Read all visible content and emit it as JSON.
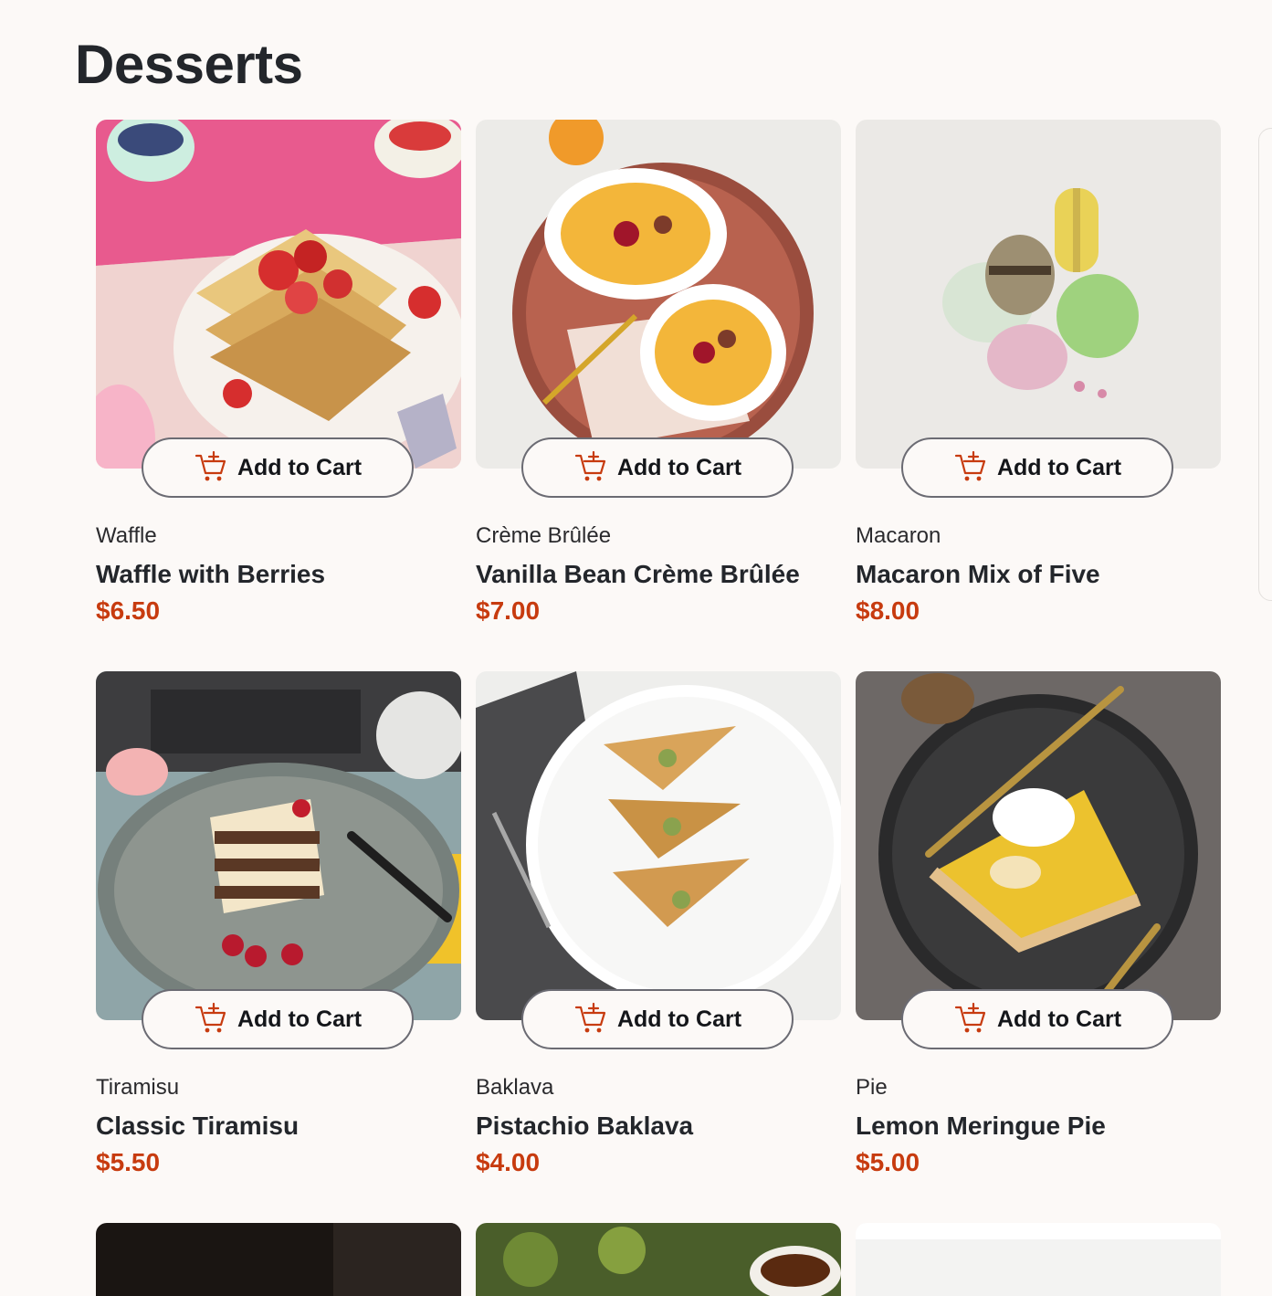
{
  "page": {
    "title": "Desserts"
  },
  "button_label": "Add to Cart",
  "accent_color": "#c73b0f",
  "products": [
    {
      "category": "Waffle",
      "name": "Waffle with Berries",
      "price": "$6.50",
      "icon": "cart-plus-icon"
    },
    {
      "category": "Crème Brûlée",
      "name": "Vanilla Bean Crème Brûlée",
      "price": "$7.00",
      "icon": "cart-plus-icon"
    },
    {
      "category": "Macaron",
      "name": "Macaron Mix of Five",
      "price": "$8.00",
      "icon": "cart-plus-icon"
    },
    {
      "category": "Tiramisu",
      "name": "Classic Tiramisu",
      "price": "$5.50",
      "icon": "cart-plus-icon"
    },
    {
      "category": "Baklava",
      "name": "Pistachio Baklava",
      "price": "$4.00",
      "icon": "cart-plus-icon"
    },
    {
      "category": "Pie",
      "name": "Lemon Meringue Pie",
      "price": "$5.00",
      "icon": "cart-plus-icon"
    }
  ]
}
